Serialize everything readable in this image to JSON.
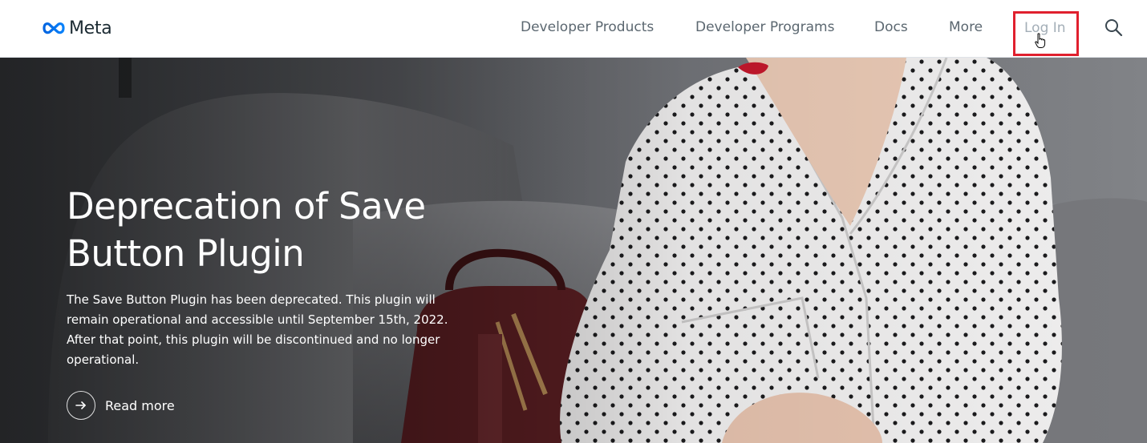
{
  "header": {
    "logo": {
      "icon": "meta-infinity-logo",
      "text": "Meta"
    },
    "nav": [
      {
        "label": "Developer Products"
      },
      {
        "label": "Developer Programs"
      },
      {
        "label": "Docs"
      },
      {
        "label": "More"
      }
    ],
    "login": {
      "label": "Log In",
      "highlight_color": "#e0202e",
      "cursor": "hand-pointer-icon"
    },
    "search": {
      "icon": "search-icon"
    }
  },
  "hero": {
    "title": "Deprecation of Save Button Plugin",
    "body": "The Save Button Plugin has been deprecated. This plugin will remain operational and accessible until September 15th, 2022. After that point, this plugin will be discontinued and no longer operational.",
    "read_more": {
      "label": "Read more",
      "icon": "arrow-right-icon"
    }
  },
  "colors": {
    "logo_blue": "#0668e1",
    "nav_text": "#5b6770",
    "login_text": "#a3aeb7",
    "hero_text": "#ffffff"
  }
}
